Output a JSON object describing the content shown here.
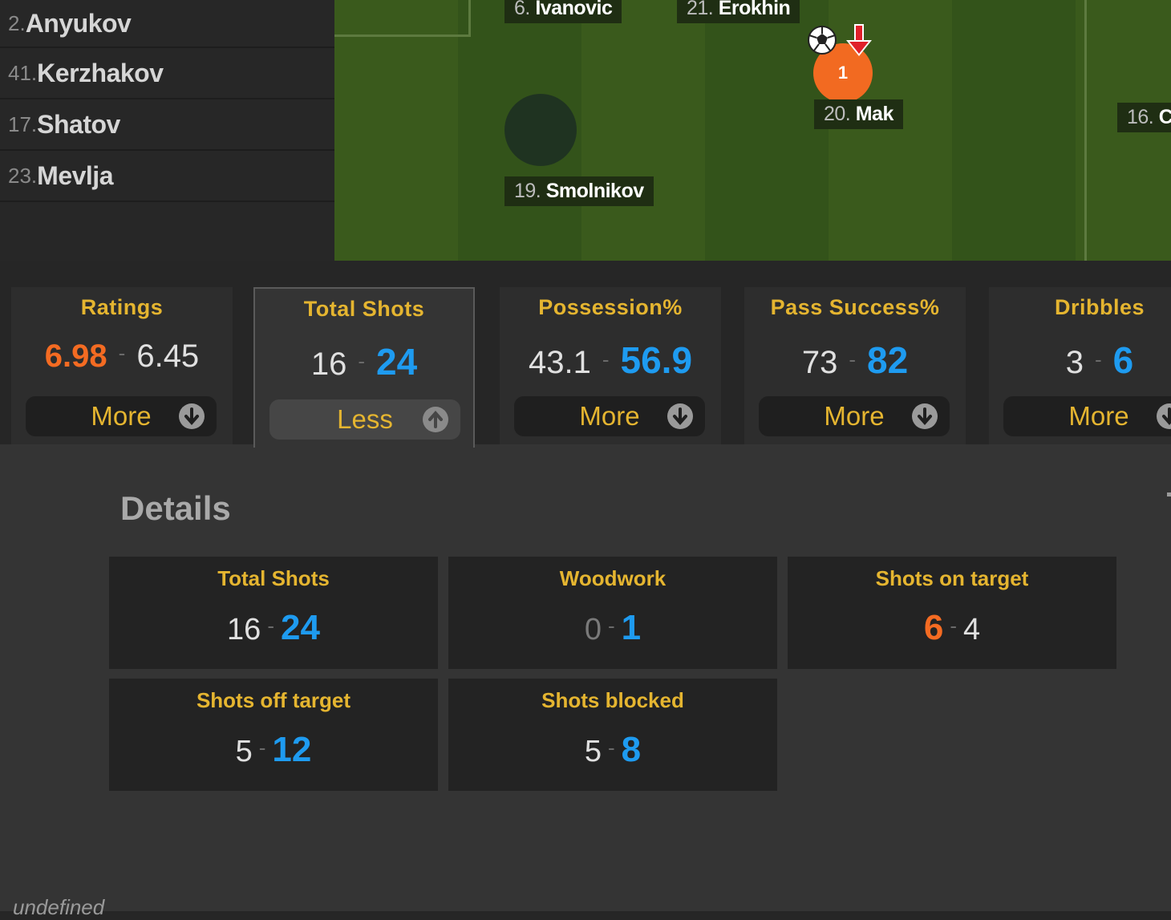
{
  "subs": [
    {
      "num": "2.",
      "name": "Anyukov"
    },
    {
      "num": "41.",
      "name": "Kerzhakov"
    },
    {
      "num": "17.",
      "name": "Shatov"
    },
    {
      "num": "23.",
      "name": "Mevlja"
    }
  ],
  "pitch": {
    "labels": [
      {
        "num": "6.",
        "name": "Ivanovic"
      },
      {
        "num": "21.",
        "name": "Erokhin"
      },
      {
        "num": "20.",
        "name": "Mak"
      },
      {
        "num": "19.",
        "name": "Smolnikov"
      },
      {
        "num": "16.",
        "name": "C"
      }
    ],
    "goal_marker": "1"
  },
  "tabs": [
    {
      "title": "Ratings",
      "home": "6.98",
      "away": "6.45",
      "button": "More"
    },
    {
      "title": "Total Shots",
      "home": "16",
      "away": "24",
      "button": "Less"
    },
    {
      "title": "Possession%",
      "home": "43.1",
      "away": "56.9",
      "button": "More"
    },
    {
      "title": "Pass Success%",
      "home": "73",
      "away": "82",
      "button": "More"
    },
    {
      "title": "Dribbles",
      "home": "3",
      "away": "6",
      "button": "More"
    }
  ],
  "separator": "-",
  "details": {
    "title": "Details",
    "cards": [
      {
        "title": "Total Shots",
        "home": "16",
        "away": "24"
      },
      {
        "title": "Woodwork",
        "home": "0",
        "away": "1"
      },
      {
        "title": "Shots on target",
        "home": "6",
        "away": "4"
      },
      {
        "title": "Shots off target",
        "home": "5",
        "away": "12"
      },
      {
        "title": "Shots blocked",
        "home": "5",
        "away": "8"
      }
    ]
  },
  "footer": "undefined",
  "colors": {
    "accent": "#e5b530",
    "home_leader": "#f46b22",
    "away_leader": "#1e9bf0"
  }
}
